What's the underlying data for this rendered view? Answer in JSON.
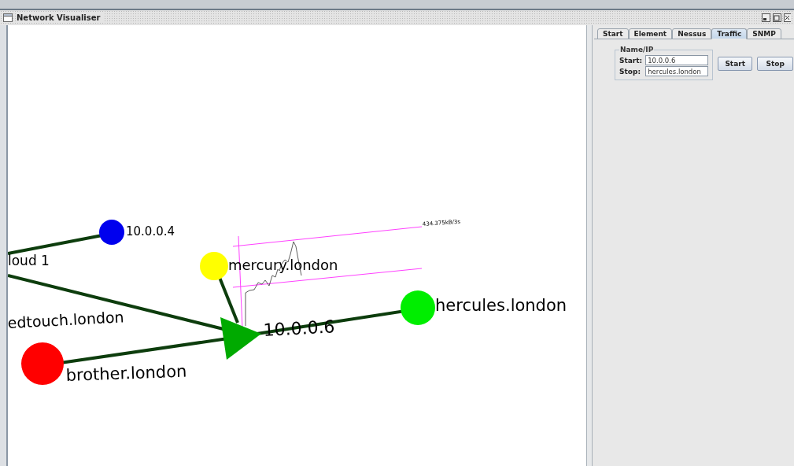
{
  "window": {
    "title": "Network Visualiser"
  },
  "graph": {
    "nodes": [
      {
        "kind": "label",
        "label": "loud 1"
      },
      {
        "kind": "circle",
        "label": "10.0.0.4",
        "color": "#0000ee"
      },
      {
        "kind": "label",
        "label": "edtouch.london"
      },
      {
        "kind": "circle",
        "label": "brother.london",
        "color": "#ff0000"
      },
      {
        "kind": "circle",
        "label": "mercury.london",
        "color": "#ffff00"
      },
      {
        "kind": "cone",
        "label": "10.0.0.6",
        "color": "#00aa00"
      },
      {
        "kind": "circle",
        "label": "hercules.london",
        "color": "#00ee00"
      }
    ],
    "traffic_reading": "434.375kB/3s"
  },
  "panel": {
    "tabs": [
      {
        "label": "Start",
        "selected": false
      },
      {
        "label": "Element",
        "selected": false
      },
      {
        "label": "Nessus",
        "selected": false
      },
      {
        "label": "Traffic",
        "selected": true
      },
      {
        "label": "SNMP",
        "selected": false
      }
    ],
    "group_title": "Name/IP",
    "fields": [
      {
        "label": "Start:",
        "value": "10.0.0.6"
      },
      {
        "label": "Stop:",
        "value": "hercules.london"
      }
    ],
    "buttons": [
      "Start",
      "Stop"
    ]
  }
}
